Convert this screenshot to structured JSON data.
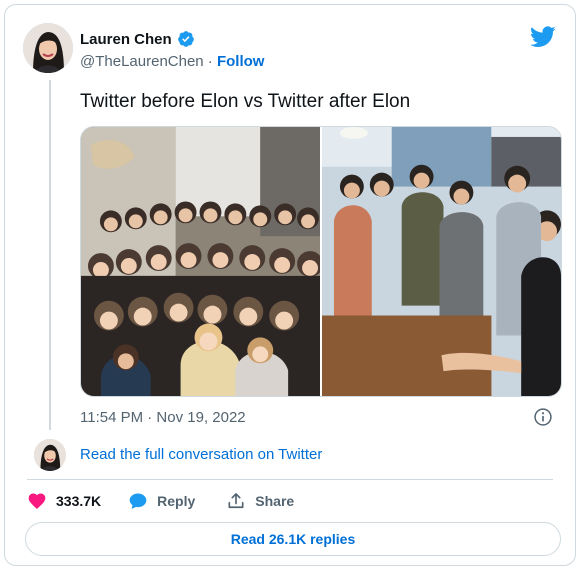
{
  "author": {
    "display_name": "Lauren Chen",
    "handle": "@TheLaurenChen",
    "separator": " · ",
    "follow_label": "Follow",
    "verified_color": "#1d9bf0"
  },
  "brand": {
    "icon": "twitter-bird-icon",
    "color": "#1d9bf0"
  },
  "tweet": {
    "text": "Twitter before Elon vs Twitter after Elon",
    "media": [
      {
        "icon": "photo-before-group"
      },
      {
        "icon": "photo-after-group"
      }
    ],
    "timestamp": "11:54 PM · Nov 19, 2022"
  },
  "conversation_link": "Read the full conversation on Twitter",
  "actions": {
    "like_count": "333.7K",
    "reply_label": "Reply",
    "share_label": "Share",
    "like_color": "#f91880",
    "reply_color": "#1d9bf0"
  },
  "read_replies_label": "Read 26.1K replies"
}
